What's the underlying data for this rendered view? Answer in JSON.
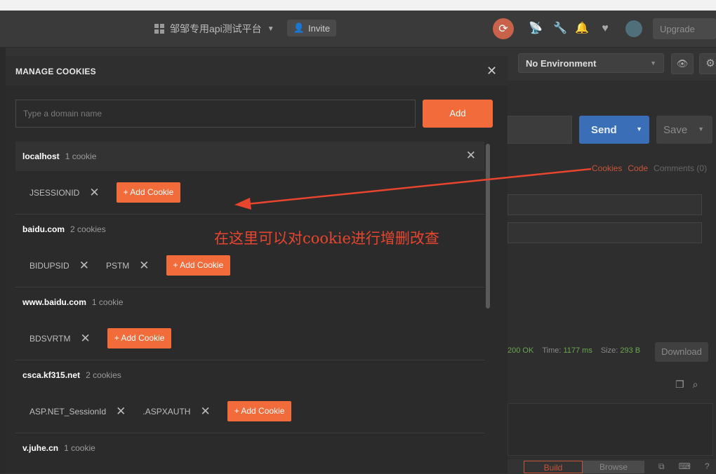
{
  "header": {
    "workspace_name": "邹邹专用api测试平台",
    "invite_label": "Invite",
    "upgrade_label": "Upgrade"
  },
  "environment": {
    "selected": "No Environment"
  },
  "request": {
    "send_label": "Send",
    "save_label": "Save",
    "subtabs": {
      "cookies": "Cookies",
      "code": "Code",
      "comments": "Comments (0)"
    }
  },
  "response": {
    "status": "200 OK",
    "time_label": "Time:",
    "time_value": "1177 ms",
    "size_label": "Size:",
    "size_value": "293 B",
    "download_label": "Download"
  },
  "bottom": {
    "build_label": "Build",
    "browse_label": "Browse"
  },
  "modal": {
    "title": "MANAGE COOKIES",
    "domain_placeholder": "Type a domain name",
    "add_label": "Add",
    "add_cookie_label": "+ Add Cookie",
    "domains": [
      {
        "name": "localhost",
        "count": "1 cookie",
        "cookies": [
          "JSESSIONID"
        ]
      },
      {
        "name": "baidu.com",
        "count": "2 cookies",
        "cookies": [
          "BIDUPSID",
          "PSTM"
        ]
      },
      {
        "name": "www.baidu.com",
        "count": "1 cookie",
        "cookies": [
          "BDSVRTM"
        ]
      },
      {
        "name": "csca.kf315.net",
        "count": "2 cookies",
        "cookies": [
          "ASP.NET_SessionId",
          ".ASPXAUTH"
        ]
      },
      {
        "name": "v.juhe.cn",
        "count": "1 cookie",
        "cookies": []
      }
    ]
  },
  "annotation": {
    "text": "在这里可以对cookie进行增删改查",
    "color": "#e8452f"
  },
  "colors": {
    "accent": "#f26b3a",
    "send_blue": "#3a6fb8",
    "background": "#333333"
  }
}
